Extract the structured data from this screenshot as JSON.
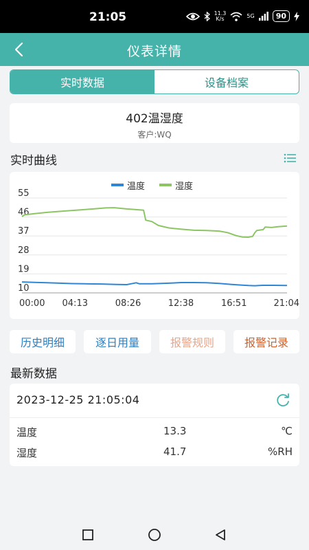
{
  "statusbar": {
    "time": "21:05",
    "speed_top": "11.3",
    "speed_bottom": "K/s",
    "network": "5G",
    "battery": "90"
  },
  "navbar": {
    "title": "仪表详情"
  },
  "tabs": [
    {
      "label": "实时数据"
    },
    {
      "label": "设备档案"
    }
  ],
  "device": {
    "name": "402温湿度",
    "client": "客户:WQ"
  },
  "sections": {
    "curve_title": "实时曲线",
    "latest_title": "最新数据"
  },
  "chart_data": {
    "type": "line",
    "x": [
      "00:00",
      "04:13",
      "08:26",
      "12:38",
      "16:51",
      "21:04"
    ],
    "yticks": [
      10,
      19,
      28,
      37,
      46,
      55
    ],
    "ylim": [
      10,
      55
    ],
    "xlim": [
      0,
      1264
    ],
    "grid": true,
    "legend": "top-center",
    "series": [
      {
        "name": "温度",
        "color": "#2f86d6",
        "points": [
          [
            0,
            15.2
          ],
          [
            60,
            15.0
          ],
          [
            120,
            14.8
          ],
          [
            180,
            14.6
          ],
          [
            240,
            14.4
          ],
          [
            300,
            14.3
          ],
          [
            380,
            14.2
          ],
          [
            450,
            14.0
          ],
          [
            500,
            13.9
          ],
          [
            520,
            14.3
          ],
          [
            545,
            14.8
          ],
          [
            560,
            14.3
          ],
          [
            620,
            14.3
          ],
          [
            700,
            14.6
          ],
          [
            760,
            14.9
          ],
          [
            820,
            14.9
          ],
          [
            880,
            14.8
          ],
          [
            940,
            14.5
          ],
          [
            1000,
            14.0
          ],
          [
            1050,
            13.7
          ],
          [
            1080,
            13.5
          ],
          [
            1110,
            13.4
          ],
          [
            1150,
            13.6
          ],
          [
            1200,
            13.6
          ],
          [
            1264,
            13.5
          ]
        ]
      },
      {
        "name": "湿度",
        "color": "#8cc563",
        "points": [
          [
            0,
            46.2
          ],
          [
            12,
            47.0
          ],
          [
            60,
            47.6
          ],
          [
            120,
            48.2
          ],
          [
            200,
            48.8
          ],
          [
            280,
            49.4
          ],
          [
            340,
            49.8
          ],
          [
            400,
            50.3
          ],
          [
            440,
            50.4
          ],
          [
            500,
            49.8
          ],
          [
            560,
            49.4
          ],
          [
            580,
            49.2
          ],
          [
            590,
            44.5
          ],
          [
            620,
            43.8
          ],
          [
            650,
            42.0
          ],
          [
            700,
            40.8
          ],
          [
            760,
            40.2
          ],
          [
            820,
            39.7
          ],
          [
            880,
            39.6
          ],
          [
            940,
            39.3
          ],
          [
            980,
            38.6
          ],
          [
            1020,
            37.2
          ],
          [
            1050,
            36.5
          ],
          [
            1080,
            36.4
          ],
          [
            1100,
            36.8
          ],
          [
            1110,
            38.5
          ],
          [
            1120,
            39.6
          ],
          [
            1150,
            40.0
          ],
          [
            1160,
            41.2
          ],
          [
            1190,
            41.0
          ],
          [
            1220,
            41.4
          ],
          [
            1264,
            41.7
          ]
        ]
      }
    ]
  },
  "actions": {
    "history": "历史明细",
    "daily": "逐日用量",
    "rules": "报警规则",
    "records": "报警记录"
  },
  "latest": {
    "timestamp": "2023-12-25 21:05:04",
    "rows": [
      {
        "label": "温度",
        "value": "13.3",
        "unit": "℃"
      },
      {
        "label": "湿度",
        "value": "41.7",
        "unit": "%RH"
      }
    ]
  }
}
